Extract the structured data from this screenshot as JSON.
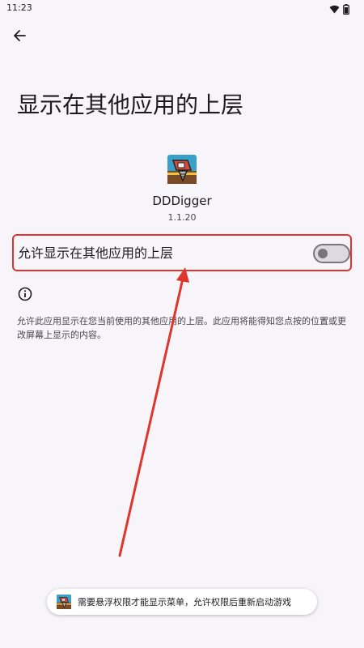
{
  "status_bar": {
    "time": "11:23",
    "icons": [
      "wifi-icon",
      "battery-icon"
    ]
  },
  "header": {
    "back_icon": "arrow-back-icon"
  },
  "page": {
    "title": "显示在其他应用的上层"
  },
  "app": {
    "icon": "dddigger-app-icon",
    "name": "DDDigger",
    "version": "1.1.20"
  },
  "permission": {
    "label": "允许显示在其他应用的上层",
    "enabled": false,
    "highlight_color": "#e0352d"
  },
  "info": {
    "icon": "info-icon",
    "description": "允许此应用显示在您当前使用的其他应用的上层。此应用将能得知您点按的位置或更改屏幕上显示的内容。"
  },
  "toast": {
    "icon": "dddigger-app-icon",
    "text": "需要悬浮权限才能显示菜单，允许权限后重新启动游戏"
  },
  "annotation": {
    "arrow_color": "#e0352d"
  }
}
